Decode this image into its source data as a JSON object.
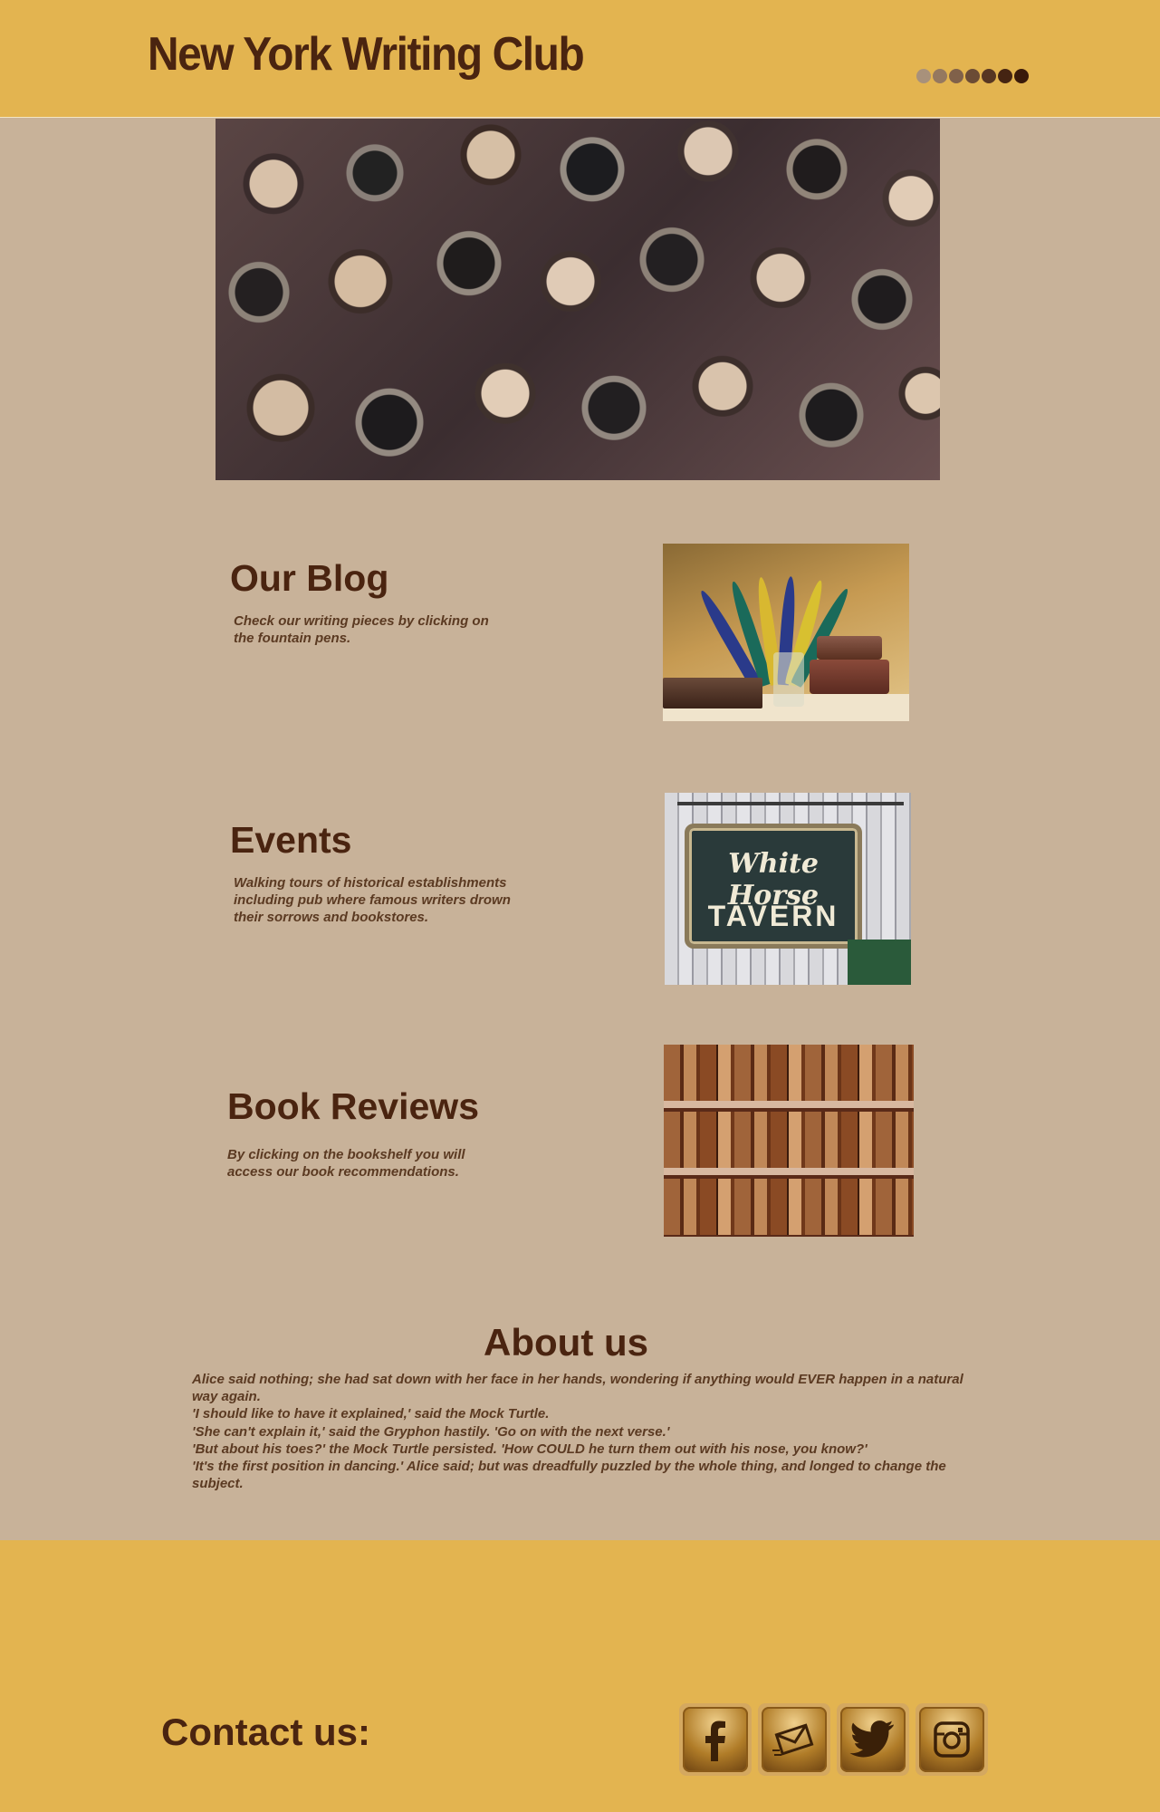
{
  "header": {
    "title": "New York Writing Club",
    "slider_dots": [
      "#a8917b",
      "#95785f",
      "#80614a",
      "#6b4b35",
      "#573622",
      "#452412",
      "#3a1a0a"
    ]
  },
  "hero": {
    "icon": "typewriter-keys-image"
  },
  "sections": [
    {
      "title": "Our Blog",
      "description": "Check our writing pieces by clicking on the fountain pens.",
      "image": "quill-pens-image"
    },
    {
      "title": "Events",
      "description": "Walking tours of historical establishments including pub where famous writers drown their sorrows and bookstores.",
      "image": "white-horse-tavern-image",
      "image_text_top": "White Horse",
      "image_text_bottom": "TAVERN"
    },
    {
      "title": "Book Reviews",
      "description": "By clicking on the bookshelf you will access our book recommendations.",
      "image": "bookshelf-image"
    }
  ],
  "about": {
    "title": "About us",
    "lines": [
      "Alice said nothing; she had sat down with her face in her hands, wondering if anything would EVER happen in a natural way again.",
      "'I should like to have it explained,' said the Mock Turtle.",
      "'She can't explain it,' said the Gryphon hastily. 'Go on with the next verse.'",
      "'But about his toes?' the Mock Turtle persisted. 'How COULD he turn them out with his nose, you know?'",
      "'It's the first position in dancing.' Alice said; but was dreadfully puzzled by the whole thing, and longed to change the subject."
    ]
  },
  "footer": {
    "contact_label": "Contact us:",
    "social": [
      "facebook-icon",
      "mail-icon",
      "twitter-icon",
      "instagram-icon"
    ]
  },
  "colors": {
    "header_bg": "#e3b450",
    "body_bg": "#c8b299",
    "text": "#4a2410"
  }
}
